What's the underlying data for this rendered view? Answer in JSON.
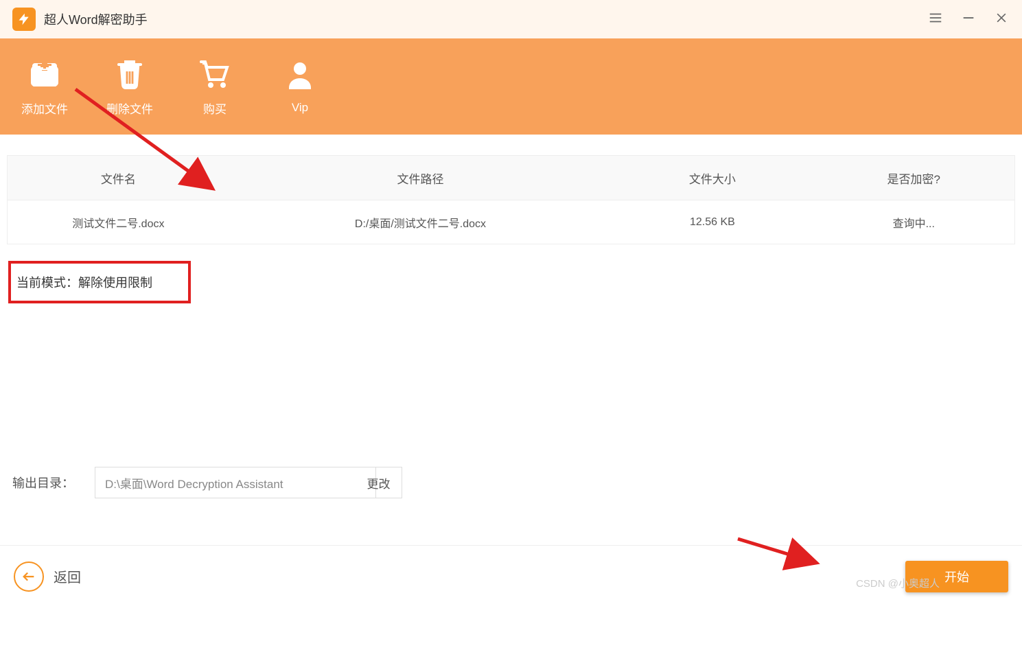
{
  "app": {
    "title": "超人Word解密助手"
  },
  "toolbar": {
    "add_file": "添加文件",
    "delete_file": "删除文件",
    "buy": "购买",
    "vip": "Vip"
  },
  "table": {
    "headers": {
      "name": "文件名",
      "path": "文件路径",
      "size": "文件大小",
      "enc": "是否加密?"
    },
    "rows": [
      {
        "name": "测试文件二号.docx",
        "path": "D:/桌面/测试文件二号.docx",
        "size": "12.56 KB",
        "enc": "查询中..."
      }
    ]
  },
  "mode": {
    "label": "当前模式：解除使用限制"
  },
  "output": {
    "label": "输出目录：",
    "path": "D:\\桌面\\Word Decryption Assistant",
    "change": "更改"
  },
  "footer": {
    "back": "返回",
    "start": "开始"
  },
  "watermark": "CSDN @小奥超人"
}
